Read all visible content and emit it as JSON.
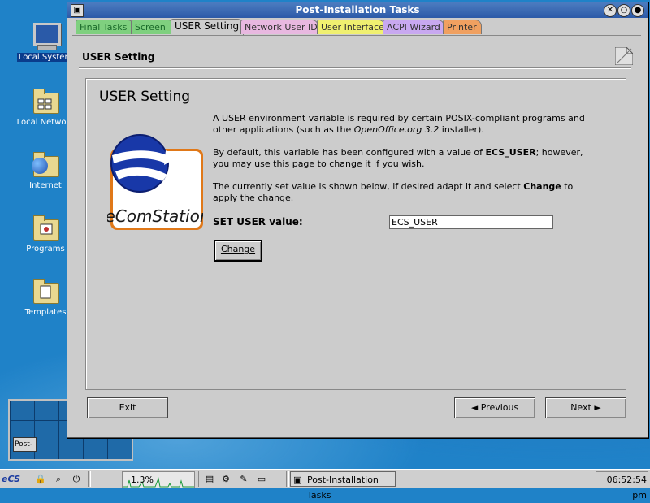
{
  "desktop": {
    "icons": [
      {
        "label": "Local System",
        "icon": "computer-icon"
      },
      {
        "label": "Local Network",
        "icon": "network-folder-icon"
      },
      {
        "label": "Internet",
        "icon": "internet-folder-icon"
      },
      {
        "label": "Programs",
        "icon": "programs-folder-icon"
      },
      {
        "label": "Templates",
        "icon": "templates-folder-icon"
      }
    ],
    "pager_window_label": "Post-"
  },
  "window": {
    "title": "Post-Installation Tasks",
    "tabs": [
      {
        "label": "Final Tasks",
        "color": "#7fd07f",
        "text": "#1a6a2a"
      },
      {
        "label": "Screen",
        "color": "#7fd07f",
        "text": "#1a6a2a"
      },
      {
        "label": "USER Setting",
        "color": "#cccccc",
        "text": "#000000",
        "active": true
      },
      {
        "label": "Network User ID",
        "color": "#e8b8e0",
        "text": "#333333"
      },
      {
        "label": "User Interface",
        "color": "#f0f070",
        "text": "#333333"
      },
      {
        "label": "ACPI Wizard",
        "color": "#c8a8f0",
        "text": "#333333"
      },
      {
        "label": "Printer",
        "color": "#f0a060",
        "text": "#333333"
      }
    ],
    "page_header": "USER Setting",
    "panel": {
      "title": "USER Setting",
      "logo_text": "eComStation",
      "para1_a": "A USER environment variable is required by certain POSIX-compliant programs and other applications (such as the ",
      "para1_italic": "OpenOffice.org 3.2",
      "para1_b": " installer).",
      "para2_a": "By default, this variable has been configured with a value of ",
      "para2_bold": "ECS_USER",
      "para2_b": "; however, you may use this page to change it if you wish.",
      "para3_a": "The currently set value is shown below, if desired adapt it and select ",
      "para3_bold": "Change",
      "para3_b": " to apply the change.",
      "set_label": "SET USER value:",
      "set_value": "ECS_USER",
      "change_button": "Change"
    },
    "buttons": {
      "exit": "Exit",
      "previous": "◄ Previous",
      "next": "Next ►"
    }
  },
  "taskbar": {
    "start_label": "eCS",
    "cpu_load": "1.3%",
    "task_button": "Post-Installation Tasks",
    "clock": "06:52:54 pm"
  },
  "colors": {
    "desktop": "#1f82c8",
    "titlebar": "#2c5aa8",
    "window_bg": "#cccccc"
  }
}
